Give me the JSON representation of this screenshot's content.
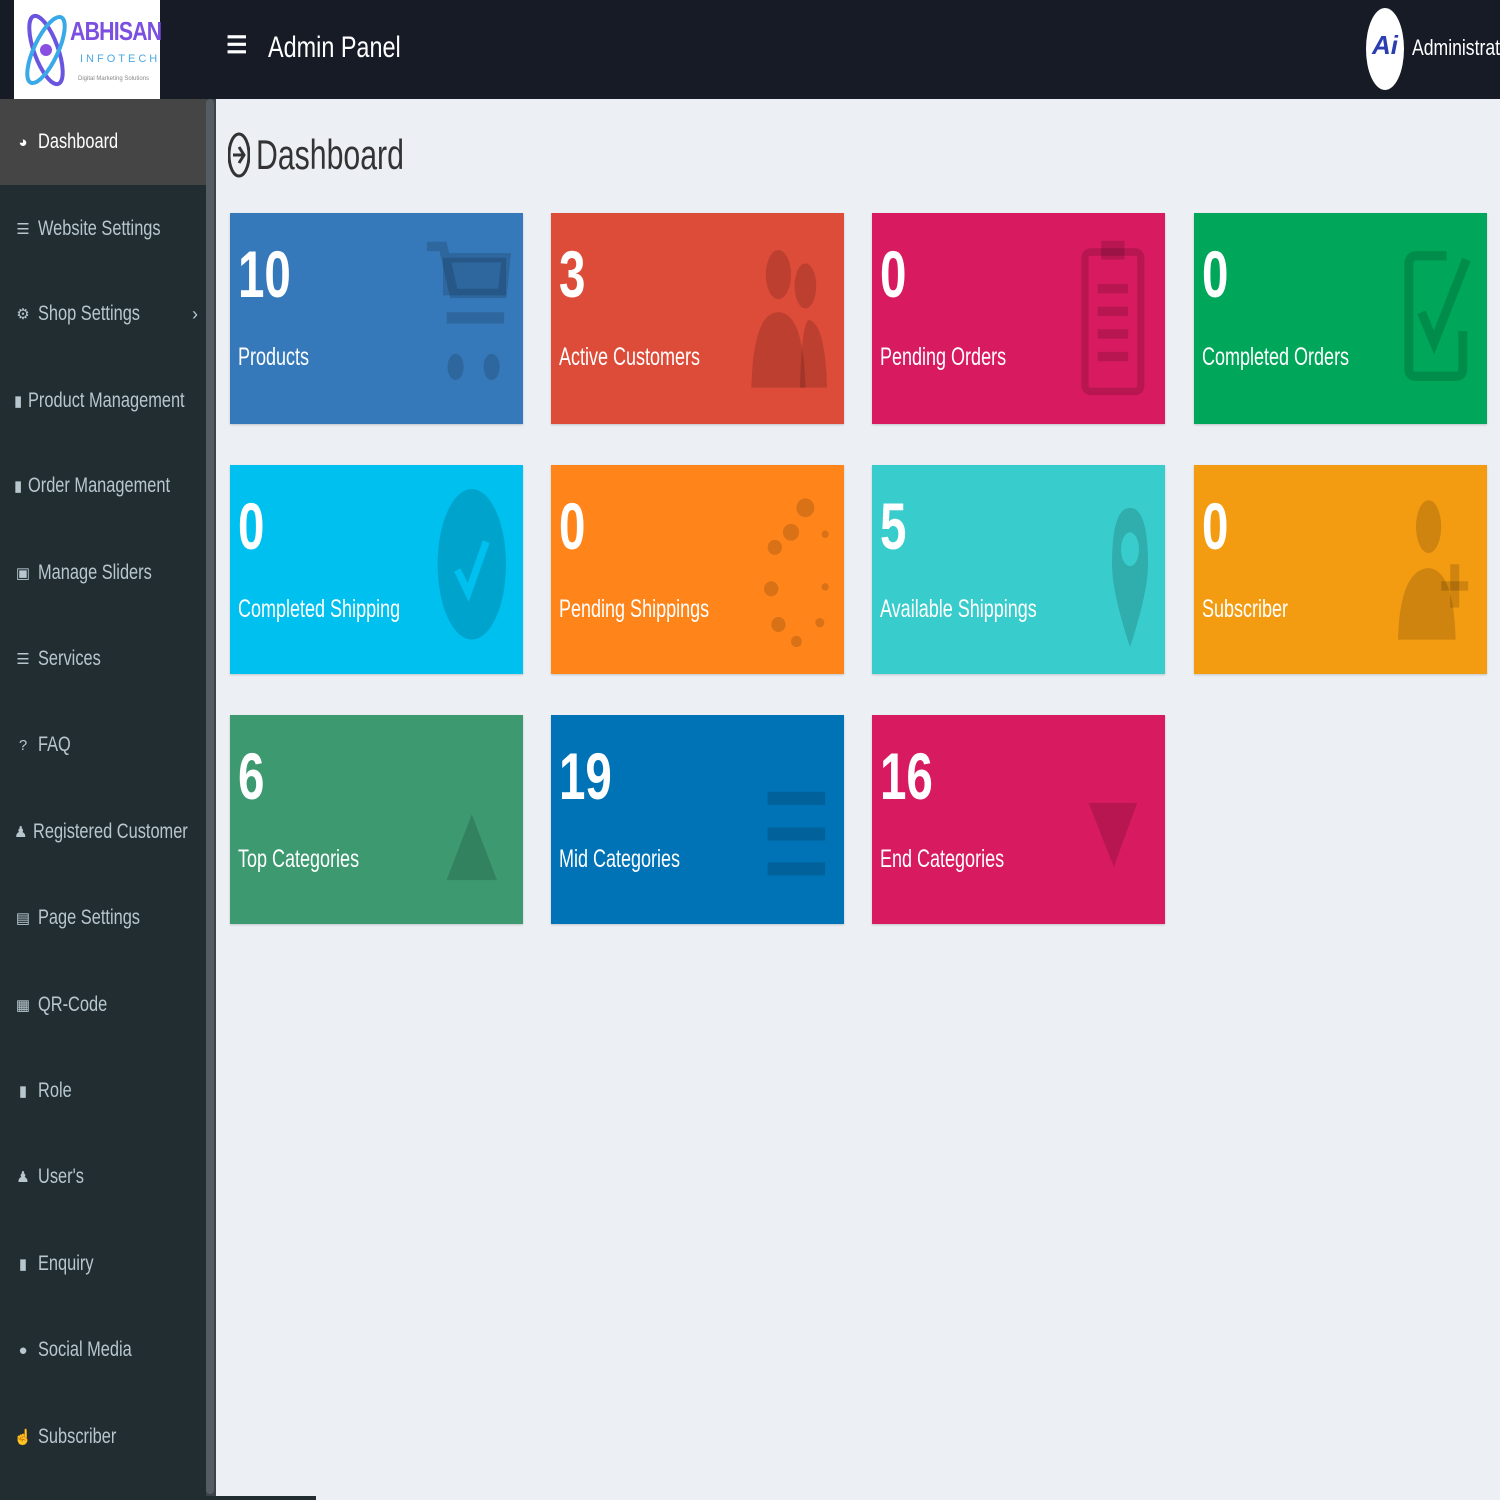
{
  "header": {
    "logo": {
      "title": "ABHISAN",
      "subtitle": "INFOTECH",
      "tagline": "Digital Marketing Solutions"
    },
    "menu_icon": "hamburger-icon",
    "app_title": "Admin Panel",
    "user": {
      "avatar_text": "Ai",
      "name": "Administrator"
    }
  },
  "sidebar": {
    "items": [
      {
        "label": "Dashboard",
        "icon": "dashboard-icon"
      },
      {
        "label": "Website Settings",
        "icon": "sliders-icon"
      },
      {
        "label": "Shop Settings",
        "icon": "cogs-icon",
        "chevron": "›"
      },
      {
        "label": "Product Management",
        "icon": "shopping-bag-icon"
      },
      {
        "label": "Order Management",
        "icon": "file-icon"
      },
      {
        "label": "Manage Sliders",
        "icon": "image-icon"
      },
      {
        "label": "Services",
        "icon": "list-icon"
      },
      {
        "label": "FAQ",
        "icon": "question-icon"
      },
      {
        "label": "Registered Customer",
        "icon": "user-plus-icon"
      },
      {
        "label": "Page Settings",
        "icon": "page-icon"
      },
      {
        "label": "QR-Code",
        "icon": "qrcode-icon"
      },
      {
        "label": "Role",
        "icon": "lock-icon"
      },
      {
        "label": "User's",
        "icon": "user-icon"
      },
      {
        "label": "Enquiry",
        "icon": "mobile-icon"
      },
      {
        "label": "Social Media",
        "icon": "globe-icon"
      },
      {
        "label": "Subscriber",
        "icon": "thumbs-up-icon"
      }
    ]
  },
  "page": {
    "title": "Dashboard",
    "title_icon": "arrow-circle-right-icon"
  },
  "tiles": [
    {
      "value": "10",
      "label": "Products",
      "color": "#3679ba",
      "icon": "shopping-cart-icon"
    },
    {
      "value": "3",
      "label": "Active Customers",
      "color": "#dd4b39",
      "icon": "users-icon"
    },
    {
      "value": "0",
      "label": "Pending Orders",
      "color": "#d81b60",
      "icon": "clipboard-icon"
    },
    {
      "value": "0",
      "label": "Completed Orders",
      "color": "#00a65a",
      "icon": "check-square-icon"
    },
    {
      "value": "0",
      "label": "Completed Shipping",
      "color": "#00c0ef",
      "icon": "check-circle-icon"
    },
    {
      "value": "0",
      "label": "Pending Shippings",
      "color": "#ff851b",
      "icon": "spinner-icon"
    },
    {
      "value": "5",
      "label": "Available Shippings",
      "color": "#39cccc",
      "icon": "map-marker-icon"
    },
    {
      "value": "0",
      "label": "Subscriber",
      "color": "#f39c12",
      "icon": "user-plus-icon"
    },
    {
      "value": "6",
      "label": "Top Categories",
      "color": "#3d9970",
      "icon": "triangle-up-icon"
    },
    {
      "value": "19",
      "label": "Mid Categories",
      "color": "#0073b7",
      "icon": "bars-icon"
    },
    {
      "value": "16",
      "label": "End Categories",
      "color": "#d81b60",
      "icon": "triangle-down-icon"
    }
  ]
}
